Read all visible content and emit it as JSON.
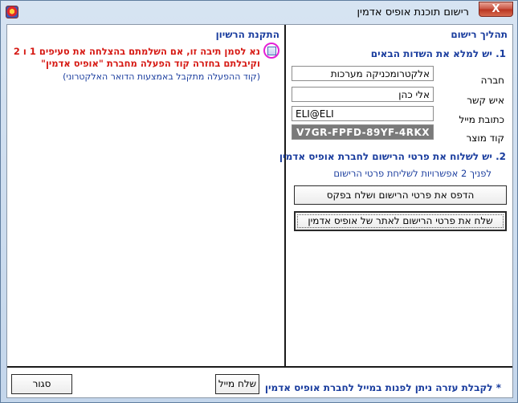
{
  "window": {
    "title": "רישום תוכנת אופיס אדמין",
    "close_symbol": "X"
  },
  "registration": {
    "title": "תהליך רישום",
    "step1_title": "1. יש למלא את השדות הבאים",
    "fields": {
      "company_label": "חברה",
      "company_value": "אלקטרומכניקה מערכות",
      "contact_label": "איש קשר",
      "contact_value": "אלי כהן",
      "email_label": "כתובת מייל",
      "email_value": "ELI@ELI",
      "product_label": "קוד מוצר",
      "product_value": "V7GR-FPFD-89YF-4RKX"
    },
    "step2_title": "2. יש לשלוח את פרטי הרישום לחברת אופיס אדמין",
    "step2_subtitle": "לפניך 2 אפשרויות לשליחת פרטי הרישום",
    "fax_button": "הדפס את פרטי הרישום ושלח בפקס",
    "site_button": "שלח את פרטי הרישום לאתר של אופיס אדמין"
  },
  "license": {
    "title": "התקנת הרשיון",
    "line1": "נא לסמן תיבה זו, אם השלמתם בהצלחה את סעיפים 1 ו 2",
    "line2": "וקיבלתם בחזרה קוד הפעלה מחברת \"אופיס אדמין\"",
    "line3": "(קוד ההפעלה מתקבל באמצעות הדואר האלקטרוני)",
    "checkbox_checked": false
  },
  "footer": {
    "help_text": "* לקבלת עזרה ניתן לפנות במייל לחברת אופיס אדמין",
    "mail_button": "שלח מייל",
    "close_button": "סגור"
  },
  "colors": {
    "heading_blue": "#1a3d9e",
    "warning_red": "#d61a14",
    "highlight_magenta": "#e41fd6"
  }
}
